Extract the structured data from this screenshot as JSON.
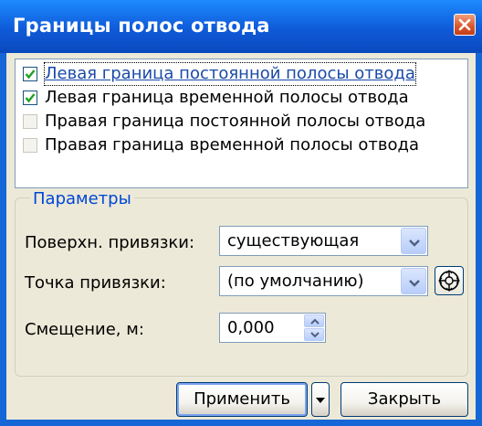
{
  "window": {
    "title": "Границы полос отвода",
    "close_icon": "close-icon"
  },
  "layers": {
    "items": [
      {
        "label": "Левая граница постоянной полосы отвода",
        "checked": true,
        "enabled": true,
        "focused": true
      },
      {
        "label": "Левая граница временной полосы отвода",
        "checked": true,
        "enabled": true,
        "focused": false
      },
      {
        "label": "Правая граница постоянной полосы отвода",
        "checked": false,
        "enabled": false,
        "focused": false
      },
      {
        "label": "Правая граница временной полосы отвода",
        "checked": false,
        "enabled": false,
        "focused": false
      }
    ]
  },
  "params": {
    "title": "Параметры",
    "surface_label": "Поверхн. привязки:",
    "surface_value": "существующая",
    "point_label": "Точка привязки:",
    "point_value": "(по умолчанию)",
    "pick_icon": "target-crosshair-icon",
    "offset_label": "Смещение, м:",
    "offset_value": "0,000"
  },
  "buttons": {
    "apply": "Применить",
    "close": "Закрыть"
  },
  "colors": {
    "titlebar": "#0f5ad8",
    "dialog_bg": "#ece9d8",
    "group_title": "#0046d5",
    "check": "#21a121"
  }
}
